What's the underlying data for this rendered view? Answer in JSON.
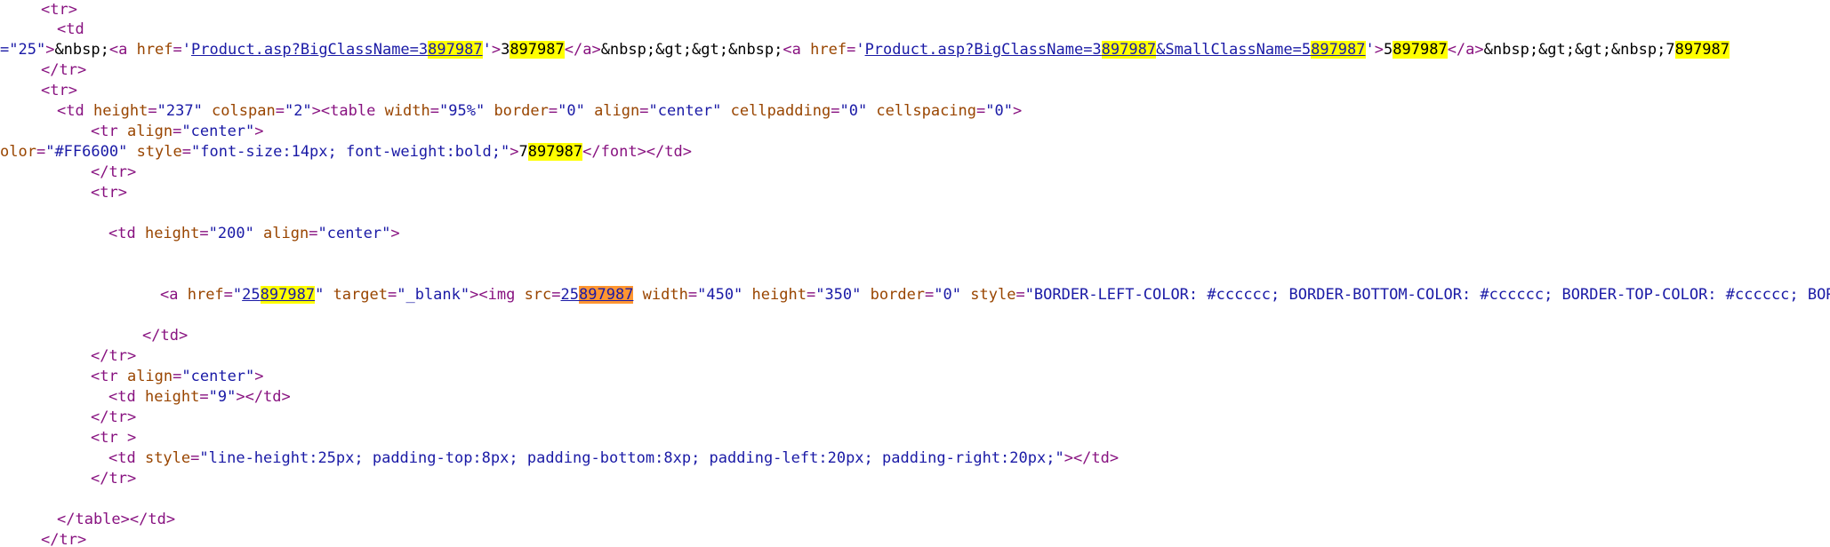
{
  "search": {
    "match_text": "897987",
    "highlight_color": "#ffff00",
    "current_match_color": "#ff9632"
  },
  "source_lines": [
    {
      "id": "l1",
      "segments": [
        {
          "k": "tg",
          "t": "<tr>"
        }
      ]
    },
    {
      "id": "l2",
      "segments": [
        {
          "k": "tg",
          "t": "<td"
        }
      ]
    },
    {
      "id": "l3",
      "segments": [
        {
          "k": "av",
          "t": "=\"25\""
        },
        {
          "k": "tg",
          "t": ">"
        },
        {
          "k": "tx",
          "t": "&nbsp;"
        },
        {
          "k": "tg",
          "t": "<a "
        },
        {
          "k": "an",
          "t": "href"
        },
        {
          "k": "tg",
          "t": "="
        },
        {
          "k": "av",
          "t": "'"
        },
        {
          "k": "lk",
          "t": "Product.asp?BigClassName=3"
        },
        {
          "k": "lkh",
          "t": "897987"
        },
        {
          "k": "av",
          "t": "'"
        },
        {
          "k": "tg",
          "t": ">"
        },
        {
          "k": "tx",
          "t": "3"
        },
        {
          "k": "hl",
          "t": "897987"
        },
        {
          "k": "tg",
          "t": "</a>"
        },
        {
          "k": "tx",
          "t": "&nbsp;&gt;&gt;&nbsp;"
        },
        {
          "k": "tg",
          "t": "<a "
        },
        {
          "k": "an",
          "t": "href"
        },
        {
          "k": "tg",
          "t": "="
        },
        {
          "k": "av",
          "t": "'"
        },
        {
          "k": "lk",
          "t": "Product.asp?BigClassName=3"
        },
        {
          "k": "lkh",
          "t": "897987"
        },
        {
          "k": "lk",
          "t": "&SmallClassName=5"
        },
        {
          "k": "lkh",
          "t": "897987"
        },
        {
          "k": "av",
          "t": "'"
        },
        {
          "k": "tg",
          "t": ">"
        },
        {
          "k": "tx",
          "t": "5"
        },
        {
          "k": "hl",
          "t": "897987"
        },
        {
          "k": "tg",
          "t": "</a>"
        },
        {
          "k": "tx",
          "t": "&nbsp;&gt;&gt;&nbsp;7"
        },
        {
          "k": "hl",
          "t": "897987"
        },
        {
          "k": "sp",
          "t": "                       "
        },
        {
          "k": "tg",
          "t": "</"
        }
      ]
    },
    {
      "id": "l4",
      "segments": [
        {
          "k": "tg",
          "t": "</tr>"
        }
      ]
    },
    {
      "id": "l5",
      "segments": [
        {
          "k": "tg",
          "t": "<tr>"
        }
      ]
    },
    {
      "id": "l6",
      "segments": [
        {
          "k": "tg",
          "t": "<td "
        },
        {
          "k": "an",
          "t": "height"
        },
        {
          "k": "tg",
          "t": "="
        },
        {
          "k": "av",
          "t": "\"237\""
        },
        {
          "k": "an",
          "t": " colspan"
        },
        {
          "k": "tg",
          "t": "="
        },
        {
          "k": "av",
          "t": "\"2\""
        },
        {
          "k": "tg",
          "t": ">"
        },
        {
          "k": "tg",
          "t": "<table "
        },
        {
          "k": "an",
          "t": "width"
        },
        {
          "k": "tg",
          "t": "="
        },
        {
          "k": "av",
          "t": "\"95%\""
        },
        {
          "k": "an",
          "t": " border"
        },
        {
          "k": "tg",
          "t": "="
        },
        {
          "k": "av",
          "t": "\"0\""
        },
        {
          "k": "an",
          "t": " align"
        },
        {
          "k": "tg",
          "t": "="
        },
        {
          "k": "av",
          "t": "\"center\""
        },
        {
          "k": "an",
          "t": " cellpadding"
        },
        {
          "k": "tg",
          "t": "="
        },
        {
          "k": "av",
          "t": "\"0\""
        },
        {
          "k": "an",
          "t": " cellspacing"
        },
        {
          "k": "tg",
          "t": "="
        },
        {
          "k": "av",
          "t": "\"0\""
        },
        {
          "k": "tg",
          "t": ">"
        }
      ]
    },
    {
      "id": "l7",
      "segments": [
        {
          "k": "tg",
          "t": "<tr "
        },
        {
          "k": "an",
          "t": "align"
        },
        {
          "k": "tg",
          "t": "="
        },
        {
          "k": "av",
          "t": "\"center\""
        },
        {
          "k": "tg",
          "t": ">"
        }
      ]
    },
    {
      "id": "l8",
      "segments": [
        {
          "k": "an",
          "t": "olor"
        },
        {
          "k": "tg",
          "t": "="
        },
        {
          "k": "av",
          "t": "\"#FF6600\""
        },
        {
          "k": "an",
          "t": " style"
        },
        {
          "k": "tg",
          "t": "="
        },
        {
          "k": "av",
          "t": "\"font-size:14px; font-weight:bold;\""
        },
        {
          "k": "tg",
          "t": ">"
        },
        {
          "k": "tx",
          "t": "7"
        },
        {
          "k": "hl",
          "t": "897987"
        },
        {
          "k": "tg",
          "t": "</font></td>"
        }
      ]
    },
    {
      "id": "l9",
      "segments": [
        {
          "k": "tg",
          "t": "</tr>"
        }
      ]
    },
    {
      "id": "l10",
      "segments": [
        {
          "k": "tg",
          "t": "<tr>"
        }
      ]
    },
    {
      "id": "l11",
      "segments": [
        {
          "k": "tg",
          "t": "<td "
        },
        {
          "k": "an",
          "t": "height"
        },
        {
          "k": "tg",
          "t": "="
        },
        {
          "k": "av",
          "t": "\"200\""
        },
        {
          "k": "an",
          "t": " align"
        },
        {
          "k": "tg",
          "t": "="
        },
        {
          "k": "av",
          "t": "\"center\""
        },
        {
          "k": "tg",
          "t": ">"
        }
      ]
    },
    {
      "id": "l12",
      "segments": [
        {
          "k": "tg",
          "t": "<a "
        },
        {
          "k": "an",
          "t": "href"
        },
        {
          "k": "tg",
          "t": "="
        },
        {
          "k": "av",
          "t": "\""
        },
        {
          "k": "lk",
          "t": "25"
        },
        {
          "k": "lkh",
          "t": "897987"
        },
        {
          "k": "av",
          "t": "\""
        },
        {
          "k": "an",
          "t": " target"
        },
        {
          "k": "tg",
          "t": "="
        },
        {
          "k": "av",
          "t": "\"_blank\""
        },
        {
          "k": "tg",
          "t": ">"
        },
        {
          "k": "tg",
          "t": "<img "
        },
        {
          "k": "an",
          "t": "src"
        },
        {
          "k": "tg",
          "t": "="
        },
        {
          "k": "lk",
          "t": "25"
        },
        {
          "k": "lkc",
          "t": "897987"
        },
        {
          "k": "an",
          "t": " width"
        },
        {
          "k": "tg",
          "t": "="
        },
        {
          "k": "av",
          "t": "\"450\""
        },
        {
          "k": "an",
          "t": " height"
        },
        {
          "k": "tg",
          "t": "="
        },
        {
          "k": "av",
          "t": "\"350\""
        },
        {
          "k": "an",
          "t": " border"
        },
        {
          "k": "tg",
          "t": "="
        },
        {
          "k": "av",
          "t": "\"0\""
        },
        {
          "k": "an",
          "t": " style"
        },
        {
          "k": "tg",
          "t": "="
        },
        {
          "k": "av",
          "t": "\"BORDER-LEFT-COLOR: #cccccc; BORDER-BOTTOM-COLOR: #cccccc; BORDER-TOP-COLOR: #cccccc; BORDER-RIGHT"
        }
      ]
    },
    {
      "id": "l13",
      "segments": [
        {
          "k": "tg",
          "t": "</td>"
        }
      ]
    },
    {
      "id": "l14",
      "segments": [
        {
          "k": "tg",
          "t": "</tr>"
        }
      ]
    },
    {
      "id": "l15",
      "segments": [
        {
          "k": "tg",
          "t": "<tr "
        },
        {
          "k": "an",
          "t": "align"
        },
        {
          "k": "tg",
          "t": "="
        },
        {
          "k": "av",
          "t": "\"center\""
        },
        {
          "k": "tg",
          "t": ">"
        }
      ]
    },
    {
      "id": "l16",
      "segments": [
        {
          "k": "tg",
          "t": "<td "
        },
        {
          "k": "an",
          "t": "height"
        },
        {
          "k": "tg",
          "t": "="
        },
        {
          "k": "av",
          "t": "\"9\""
        },
        {
          "k": "tg",
          "t": "></td>"
        }
      ]
    },
    {
      "id": "l17",
      "segments": [
        {
          "k": "tg",
          "t": "</tr>"
        }
      ]
    },
    {
      "id": "l18",
      "segments": [
        {
          "k": "tg",
          "t": "<tr >"
        }
      ]
    },
    {
      "id": "l19",
      "segments": [
        {
          "k": "tg",
          "t": "<td "
        },
        {
          "k": "an",
          "t": "style"
        },
        {
          "k": "tg",
          "t": "="
        },
        {
          "k": "av",
          "t": "\"line-height:25px; padding-top:8px; padding-bottom:8xp; padding-left:20px; padding-right:20px;\""
        },
        {
          "k": "tg",
          "t": "></td>"
        }
      ]
    },
    {
      "id": "l20",
      "segments": [
        {
          "k": "tg",
          "t": "</tr>"
        }
      ]
    },
    {
      "id": "l21",
      "segments": [
        {
          "k": "tg",
          "t": "</table></td>"
        }
      ]
    },
    {
      "id": "l22",
      "segments": [
        {
          "k": "tg",
          "t": "</tr>"
        }
      ]
    }
  ]
}
